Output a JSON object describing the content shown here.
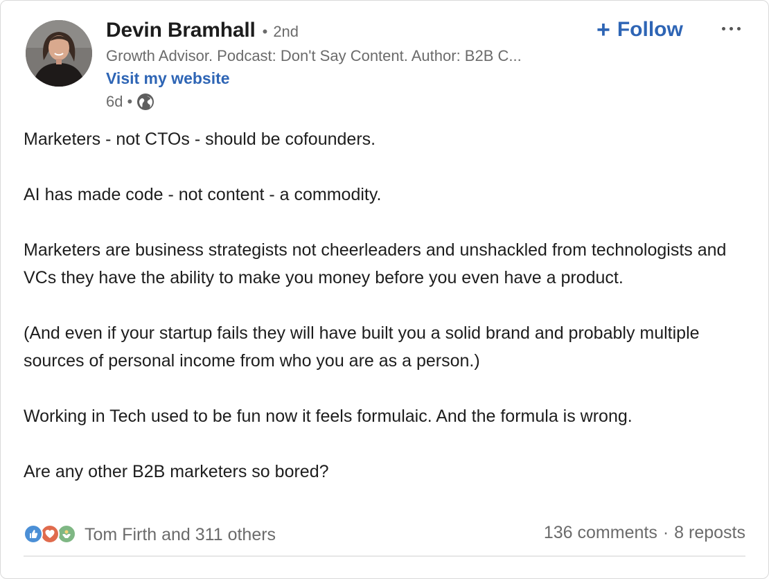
{
  "author": {
    "name": "Devin Bramhall",
    "degree": "2nd",
    "headline": "Growth Advisor. Podcast: Don't Say Content. Author: B2B C...",
    "website_label": "Visit my website",
    "timestamp": "6d",
    "visibility_icon": "globe-icon"
  },
  "actions": {
    "follow_label": "Follow",
    "follow_icon": "plus-icon",
    "more_icon": "more-options-icon"
  },
  "post": {
    "paragraphs": [
      "Marketers - not CTOs - should be cofounders.",
      "AI has made code - not content - a commodity.",
      "Marketers are business strategists not cheerleaders and unshackled from technologists and VCs they have the ability to make you money before you even have a product.",
      "(And even if your startup fails they will have built you a solid brand and probably multiple sources of personal income from who you are as a person.)",
      "Working in Tech used to be fun now it feels formulaic. And the formula is wrong.",
      "Are any other B2B marketers so bored?"
    ]
  },
  "social": {
    "reaction_icons": [
      "like-icon",
      "love-icon",
      "support-icon"
    ],
    "reactions_label": "Tom Firth and 311 others",
    "comments_label": "136 comments",
    "reposts_label": "8 reposts"
  },
  "colors": {
    "link_blue": "#2e65b5",
    "muted_text": "#6b6b6b",
    "body_text": "#1d1d1d"
  }
}
